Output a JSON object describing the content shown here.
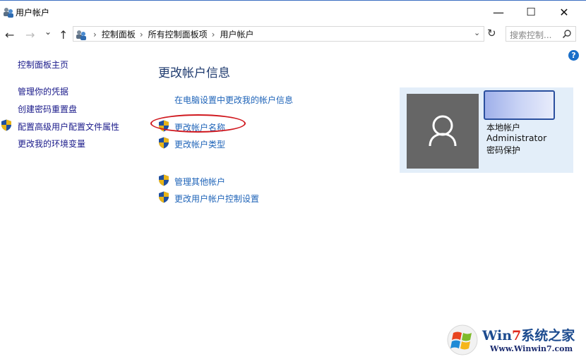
{
  "window": {
    "title": "用户帐户",
    "minimize_glyph": "—",
    "maximize_glyph": "☐",
    "close_glyph": "✕"
  },
  "nav": {
    "back_glyph": "←",
    "forward_glyph": "→",
    "recent_glyph": "⌄",
    "up_glyph": "↑",
    "breadcrumb": [
      "控制面板",
      "所有控制面板项",
      "用户帐户"
    ],
    "breadcrumb_sep": "›",
    "dropdown_glyph": "⌄",
    "refresh_glyph": "↻",
    "search_placeholder": "搜索控制..."
  },
  "help": {
    "label": "?"
  },
  "sidebar": {
    "items": [
      {
        "label": "控制面板主页",
        "shield": false
      },
      {
        "label": "管理你的凭据",
        "shield": false
      },
      {
        "label": "创建密码重置盘",
        "shield": false
      },
      {
        "label": "配置高级用户配置文件属性",
        "shield": true
      },
      {
        "label": "更改我的环境变量",
        "shield": false
      }
    ]
  },
  "main": {
    "heading": "更改帐户信息",
    "links": [
      {
        "label": "在电脑设置中更改我的帐户信息",
        "shield": false
      },
      {
        "label": "更改帐户名称",
        "shield": true,
        "highlighted": true
      },
      {
        "label": "更改帐户类型",
        "shield": true
      },
      {
        "label": "管理其他帐户",
        "shield": true
      },
      {
        "label": "更改用户帐户控制设置",
        "shield": true
      }
    ]
  },
  "account": {
    "type": "本地帐户",
    "role": "Administrator",
    "status": "密码保护"
  },
  "watermark": {
    "title_a": "Win",
    "title_b": "7",
    "title_c": "系统之家",
    "url": "Www.Winwin7.com"
  },
  "colors": {
    "link": "#1e63b8",
    "sidebar_link": "#1a1a8a",
    "card_bg": "#e3eef9",
    "annotation": "#d0181e"
  }
}
